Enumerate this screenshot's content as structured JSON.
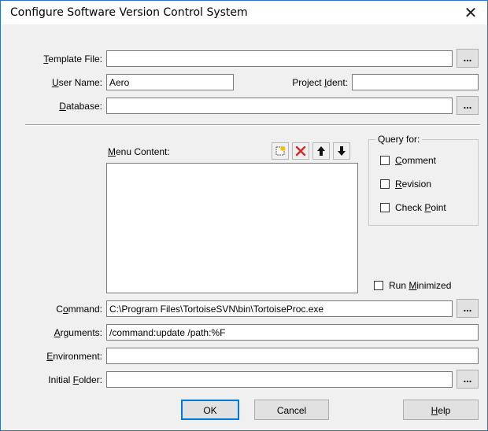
{
  "window": {
    "title": "Configure Software Version Control System",
    "close_glyph": "✕"
  },
  "labels": {
    "template_file": {
      "pre": "",
      "key": "T",
      "post": "emplate File:"
    },
    "user_name": {
      "pre": "",
      "key": "U",
      "post": "ser Name:"
    },
    "project_ident": {
      "pre": "Project ",
      "key": "I",
      "post": "dent:"
    },
    "database": {
      "pre": "",
      "key": "D",
      "post": "atabase:"
    },
    "menu_content": {
      "pre": "",
      "key": "M",
      "post": "enu Content:"
    },
    "command": {
      "pre": "C",
      "key": "o",
      "post": "mmand:"
    },
    "arguments": {
      "pre": "",
      "key": "A",
      "post": "rguments:"
    },
    "environment": {
      "pre": "",
      "key": "E",
      "post": "nvironment:"
    },
    "initial_folder": {
      "pre": "Initial ",
      "key": "F",
      "post": "older:"
    }
  },
  "fields": {
    "template_file": "",
    "user_name": "Aero",
    "project_ident": "",
    "database": "",
    "command": "C:\\Program Files\\TortoiseSVN\\bin\\TortoiseProc.exe",
    "arguments": "/command:update /path:%F",
    "environment": "",
    "initial_folder": ""
  },
  "browse_label": "...",
  "query_group": {
    "title": "Query for:",
    "items": [
      {
        "pre": "",
        "key": "C",
        "post": "omment",
        "checked": false
      },
      {
        "pre": "",
        "key": "R",
        "post": "evision",
        "checked": false
      },
      {
        "pre": "Check ",
        "key": "P",
        "post": "oint",
        "checked": false
      }
    ]
  },
  "run_minimized": {
    "pre": "Run ",
    "key": "M",
    "post": "inimized",
    "checked": false
  },
  "buttons": {
    "ok": "OK",
    "cancel": "Cancel",
    "help": {
      "pre": "",
      "key": "H",
      "post": "elp"
    }
  },
  "icons": [
    "new-item-icon",
    "delete-icon",
    "move-up-icon",
    "move-down-icon"
  ],
  "colors": {
    "accent": "#0078d7",
    "delete_red": "#d42a2a",
    "frame": "#2f73b7"
  }
}
